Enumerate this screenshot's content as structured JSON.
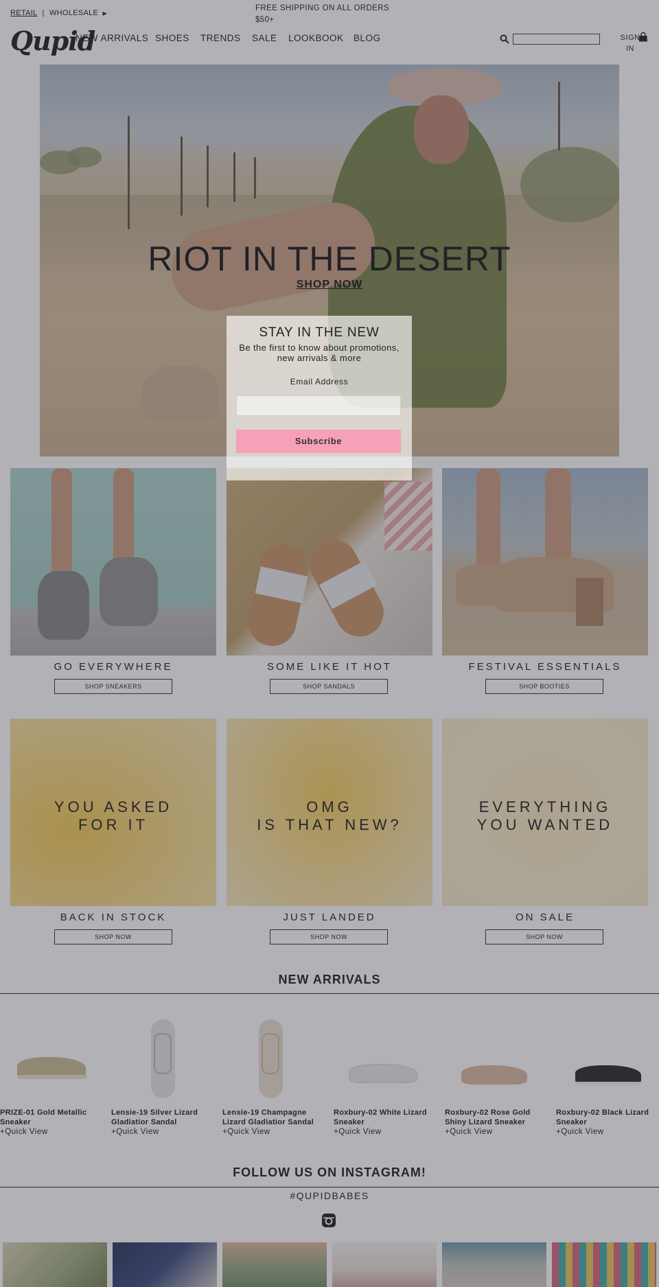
{
  "topbar": {
    "retail_label": "RETAIL",
    "separator": "|",
    "wholesale_label": "WHOLESALE",
    "shipping_line1": "FREE SHIPPING ON ALL ORDERS",
    "shipping_line2": "$50+"
  },
  "header": {
    "logo": "Qupid",
    "nav": [
      "NEW ARRIVALS",
      "SHOES",
      "TRENDS",
      "SALE",
      "LOOKBOOK",
      "BLOG"
    ],
    "signin_line1": "SIGN",
    "signin_line2": "IN",
    "search_placeholder": ""
  },
  "hero": {
    "title": "RIOT IN THE DESERT",
    "cta": "SHOP NOW"
  },
  "tiles_row1": [
    {
      "title": "GO EVERYWHERE",
      "button": "SHOP SNEAKERS"
    },
    {
      "title": "SOME LIKE IT HOT",
      "button": "SHOP SANDALS"
    },
    {
      "title": "FESTIVAL ESSENTIALS",
      "button": "SHOP BOOTIES"
    }
  ],
  "tiles_row2": [
    {
      "overlay1": "YOU ASKED",
      "overlay2": "FOR IT",
      "title": "BACK IN STOCK",
      "button": "SHOP NOW"
    },
    {
      "overlay1": "OMG",
      "overlay2": "IS THAT NEW?",
      "title": "JUST LANDED",
      "button": "SHOP NOW"
    },
    {
      "overlay1": "EVERYTHING",
      "overlay2": "YOU WANTED",
      "title": "ON SALE",
      "button": "SHOP NOW"
    }
  ],
  "new_arrivals": {
    "title": "NEW ARRIVALS",
    "products": [
      {
        "name": "PRIZE-01 Gold Metallic Sneaker",
        "quick_view": "+Quick View"
      },
      {
        "name": "Lensie-19 Silver Lizard Gladiatior Sandal",
        "quick_view": "+Quick View"
      },
      {
        "name": "Lensie-19 Champagne Lizard Gladiatior Sandal",
        "quick_view": "+Quick View"
      },
      {
        "name": "Roxbury-02 White Lizard Sneaker",
        "quick_view": "+Quick View"
      },
      {
        "name": "Roxbury-02 Rose Gold Shiny Lizard Sneaker",
        "quick_view": "+Quick View"
      },
      {
        "name": "Roxbury-02 Black Lizard Sneaker",
        "quick_view": "+Quick View"
      }
    ]
  },
  "instagram": {
    "title": "FOLLOW US ON INSTAGRAM!",
    "hashtag": "#QUPIDBABES"
  },
  "popup": {
    "title": "STAY IN THE NEW",
    "subtitle": "Be the first to know about promotions, new arrivals & more",
    "email_label": "Email Address",
    "email_value": "",
    "subscribe_label": "Subscribe"
  },
  "colors": {
    "overlay": "#46464f",
    "subscribe_button": "#f6a1b8",
    "hero_jacket": "#6b7a3b"
  },
  "icons": {
    "search": "search-icon",
    "bag": "shopping-bag-icon",
    "caret": "caret-right-icon",
    "instagram": "instagram-icon"
  }
}
